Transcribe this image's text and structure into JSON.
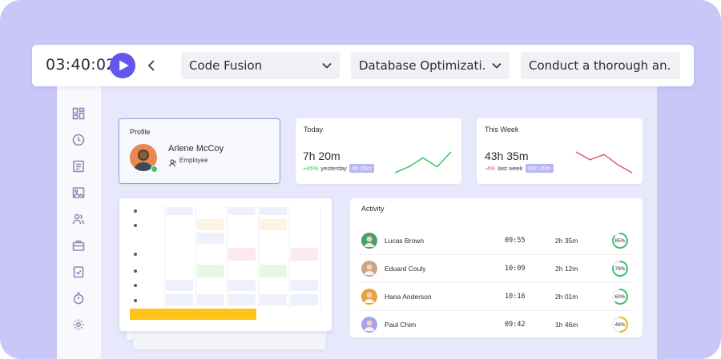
{
  "topbar": {
    "timer": "03:40:02",
    "project": "Code Fusion",
    "task": "Database Optimizati...",
    "description": "Conduct a thorough an..."
  },
  "sidebar": {
    "items": [
      {
        "icon": "dashboard-icon"
      },
      {
        "icon": "clock-icon"
      },
      {
        "icon": "document-icon"
      },
      {
        "icon": "image-icon"
      },
      {
        "icon": "users-icon"
      },
      {
        "icon": "briefcase-icon"
      },
      {
        "icon": "clipboard-check-icon"
      },
      {
        "icon": "stopwatch-icon"
      },
      {
        "icon": "gear-icon"
      }
    ]
  },
  "profile": {
    "title": "Profile",
    "name": "Arlene McCoy",
    "role": "Employee"
  },
  "today": {
    "title": "Today",
    "value": "7h 20m",
    "delta": "+45%",
    "delta_label": "yesterday",
    "compare": "4h 25m",
    "color": "#3cc46b",
    "trend": [
      2,
      4,
      7,
      4,
      9
    ]
  },
  "week": {
    "title": "This Week",
    "value": "43h 35m",
    "delta": "-4%",
    "delta_label": "last week",
    "compare": "45h 20m",
    "color": "#e25a6a",
    "trend": [
      9,
      6,
      8,
      4,
      1
    ]
  },
  "activity": {
    "title": "Activity",
    "rows": [
      {
        "name": "Lucas Brown",
        "time": "09:55",
        "duration": "2h 35m",
        "percent": 85,
        "percent_label": "85%",
        "color": "#3cc46b",
        "avatar_color": "#4e9b6e"
      },
      {
        "name": "Eduard Couly",
        "time": "10:09",
        "duration": "2h 12m",
        "percent": 79,
        "percent_label": "79%",
        "color": "#3cc46b",
        "avatar_color": "#c9a489"
      },
      {
        "name": "Hana Anderson",
        "time": "10:16",
        "duration": "2h 01m",
        "percent": 60,
        "percent_label": "60%",
        "color": "#3cc46b",
        "avatar_color": "#e8a23d"
      },
      {
        "name": "Paul Chim",
        "time": "09:42",
        "duration": "1h 46m",
        "percent": 49,
        "percent_label": "49%",
        "color": "#f2b21c",
        "avatar_color": "#a9a2e8"
      }
    ]
  }
}
